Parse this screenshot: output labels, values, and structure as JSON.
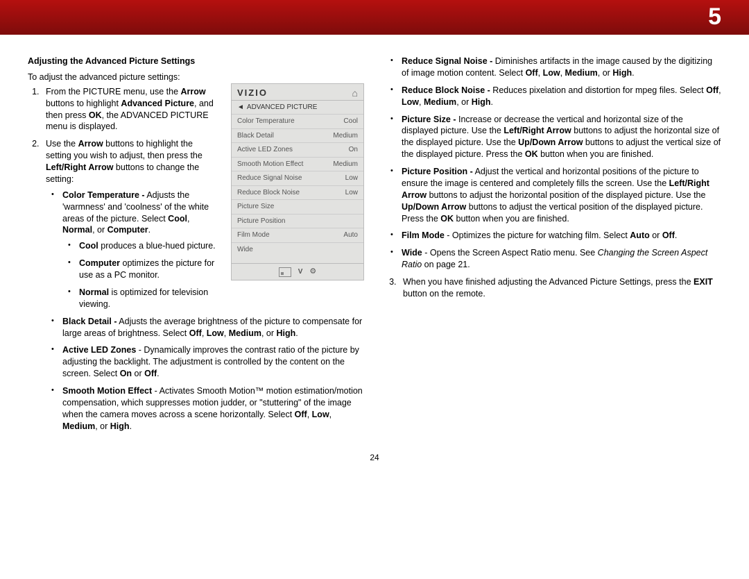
{
  "chapter_number": "5",
  "page_number": "24",
  "heading": "Adjusting the Advanced Picture Settings",
  "intro": "To adjust the advanced picture settings:",
  "step1": {
    "pre": "From the PICTURE menu, use the ",
    "arrow": "Arrow",
    "mid": " buttons to highlight ",
    "adv": "Advanced Picture",
    "mid2": ", and then press ",
    "ok": "OK",
    "post": ", the ADVANCED PICTURE menu is displayed."
  },
  "step2": {
    "pre": "Use the ",
    "arrow": "Arrow",
    "mid": " buttons to highlight the setting you wish to adjust, then press the ",
    "lr": "Left/Right Arrow",
    "post": " buttons to change the setting:"
  },
  "color_temp": {
    "title": "Color Temperature -",
    "body": " Adjusts the 'warmness' and 'coolness' of the white areas of the picture. Select ",
    "opt1": "Cool",
    "sep1": ", ",
    "opt2": "Normal",
    "sep2": ", or ",
    "opt3": "Computer",
    "end": "."
  },
  "cool": {
    "title": "Cool",
    "body": " produces a blue-hued picture."
  },
  "computer": {
    "title": "Computer",
    "body": " optimizes the picture for use as a PC monitor."
  },
  "normal": {
    "title": "Normal",
    "body": " is optimized for television viewing."
  },
  "black": {
    "title": "Black Detail -",
    "body": " Adjusts the average brightness of the picture to compensate for large areas of brightness. Select ",
    "o1": "Off",
    "s1": ", ",
    "o2": "Low",
    "s2": ", ",
    "o3": "Medium",
    "s3": ", or ",
    "o4": "High",
    "end": "."
  },
  "led": {
    "title": "Active LED Zones",
    "body": " - Dynamically improves the contrast ratio of the picture by adjusting the backlight. The adjustment is controlled by the content on the screen. Select ",
    "o1": "On",
    "s1": " or ",
    "o2": "Off",
    "end": "."
  },
  "smooth": {
    "title": "Smooth Motion Effect",
    "body": " - Activates Smooth Motion™ motion estimation/motion compensation, which suppresses motion judder, or \"stuttering\" of the image when the camera moves across a scene horizontally. Select ",
    "o1": "Off",
    "s1": ", ",
    "o2": "Low",
    "s2": ", ",
    "o3": "Medium",
    "s3": ", or ",
    "o4": "High",
    "end": "."
  },
  "signal": {
    "title": "Reduce Signal Noise -",
    "body": " Diminishes artifacts in the image caused by the digitizing of image motion content. Select ",
    "o1": "Off",
    "s1": ", ",
    "o2": "Low",
    "s2": ", ",
    "o3": "Medium",
    "s3": ", or ",
    "o4": "High",
    "end": "."
  },
  "block": {
    "title": "Reduce Block Noise -",
    "body": " Reduces pixelation and distortion for mpeg files. Select ",
    "o1": "Off",
    "s1": ", ",
    "o2": "Low",
    "s2": ", ",
    "o3": "Medium",
    "s3": ", or ",
    "o4": "High",
    "end": "."
  },
  "size": {
    "title": "Picture Size -",
    "body": " Increase or decrease the vertical and horizontal size of the displayed picture. Use the ",
    "lr": "Left/Right Arrow",
    "body2": " buttons to adjust the horizontal size of the displayed picture. Use the ",
    "ud": "Up/Down Arrow",
    "body3": " buttons to adjust the vertical size of the displayed picture. Press the ",
    "ok": "OK",
    "body4": " button when you are finished."
  },
  "position": {
    "title": "Picture Position -",
    "body": " Adjust the vertical and horizontal positions of the picture to ensure the image is centered and completely fills the screen. Use the ",
    "lr": "Left/Right Arrow",
    "body2": " buttons to adjust the horizontal position of the displayed picture. Use the ",
    "ud": "Up/Down Arrow",
    "body3": " buttons to adjust the vertical position of the displayed picture. Press the ",
    "ok": "OK",
    "body4": " button when you are finished."
  },
  "film": {
    "title": "Film Mode",
    "body": " - Optimizes the picture for watching film. Select ",
    "o1": "Auto",
    "s1": " or ",
    "o2": "Off",
    "end": "."
  },
  "wide": {
    "title": "Wide",
    "body": " - Opens the Screen Aspect Ratio menu. See ",
    "ref": "Changing the Screen Aspect Ratio",
    "body2": " on page 21."
  },
  "step3": {
    "pre": "When you have finished adjusting the Advanced Picture Settings, press the ",
    "exit": "EXIT",
    "post": " button on the remote."
  },
  "menu": {
    "brand": "VIZIO",
    "title": "ADVANCED PICTURE",
    "rows": [
      {
        "label": "Color Temperature",
        "value": "Cool"
      },
      {
        "label": "Black Detail",
        "value": "Medium"
      },
      {
        "label": "Active LED Zones",
        "value": "On"
      },
      {
        "label": "Smooth Motion Effect",
        "value": "Medium"
      },
      {
        "label": "Reduce Signal Noise",
        "value": "Low"
      },
      {
        "label": "Reduce Block Noise",
        "value": "Low"
      },
      {
        "label": "Picture Size",
        "value": ""
      },
      {
        "label": "Picture Position",
        "value": ""
      },
      {
        "label": "Film Mode",
        "value": "Auto"
      },
      {
        "label": "Wide",
        "value": ""
      }
    ]
  }
}
